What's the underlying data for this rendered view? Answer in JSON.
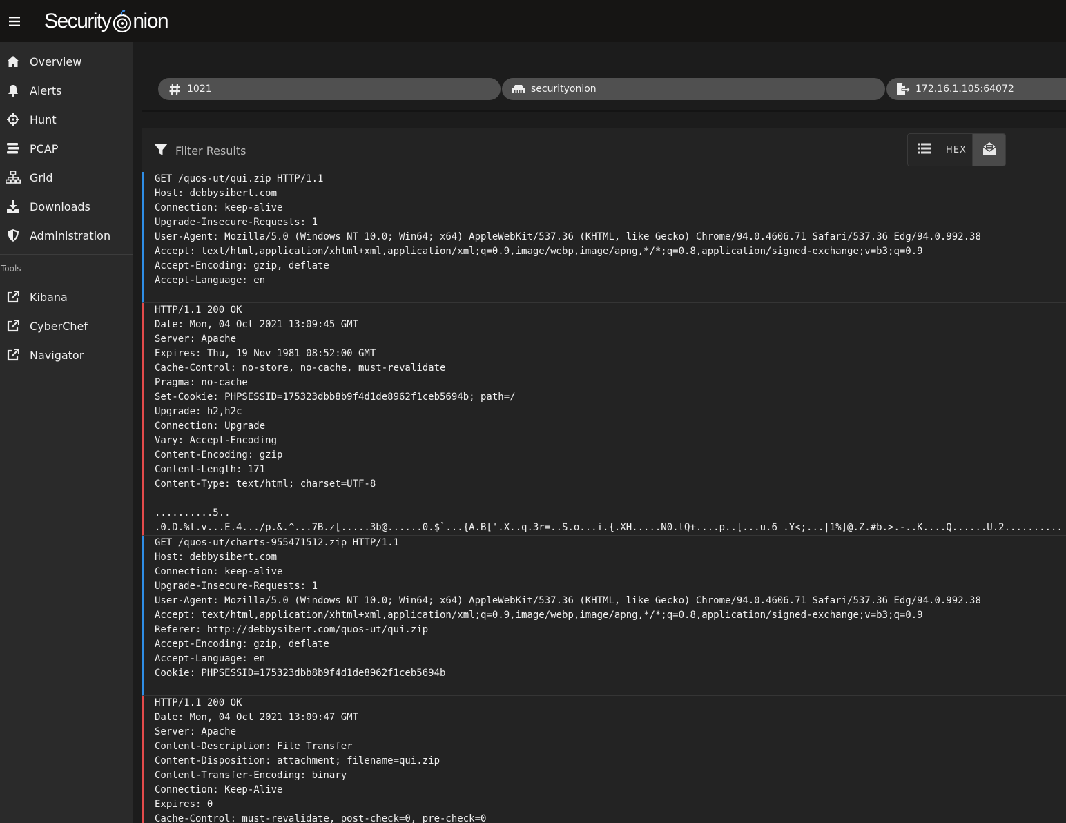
{
  "app": {
    "title": "Security Onion"
  },
  "sidebar": {
    "items": [
      {
        "label": "Overview",
        "icon": "home-icon"
      },
      {
        "label": "Alerts",
        "icon": "bell-icon"
      },
      {
        "label": "Hunt",
        "icon": "crosshairs-icon"
      },
      {
        "label": "PCAP",
        "icon": "stream-icon"
      },
      {
        "label": "Grid",
        "icon": "sitemap-icon"
      },
      {
        "label": "Downloads",
        "icon": "download-icon"
      },
      {
        "label": "Administration",
        "icon": "shield-icon"
      }
    ],
    "tools_heading": "Tools",
    "tools": [
      {
        "label": "Kibana",
        "icon": "external-link-icon"
      },
      {
        "label": "CyberChef",
        "icon": "external-link-icon"
      },
      {
        "label": "Navigator",
        "icon": "external-link-icon"
      }
    ]
  },
  "chips": [
    {
      "label": "1021",
      "icon": "hash-icon"
    },
    {
      "label": "securityonion",
      "icon": "sensor-icon"
    },
    {
      "label": "172.16.1.105:64072",
      "icon": "file-export-icon"
    }
  ],
  "filter": {
    "placeholder": "Filter Results"
  },
  "view_buttons": {
    "list": "list-icon",
    "hex": "HEX",
    "active": "envelope-open-icon"
  },
  "transcript": [
    {
      "direction": "request",
      "lines": [
        "GET /quos-ut/qui.zip HTTP/1.1",
        "Host: debbysibert.com",
        "Connection: keep-alive",
        "Upgrade-Insecure-Requests: 1",
        "User-Agent: Mozilla/5.0 (Windows NT 10.0; Win64; x64) AppleWebKit/537.36 (KHTML, like Gecko) Chrome/94.0.4606.71 Safari/537.36 Edg/94.0.992.38",
        "Accept: text/html,application/xhtml+xml,application/xml;q=0.9,image/webp,image/apng,*/*;q=0.8,application/signed-exchange;v=b3;q=0.9",
        "Accept-Encoding: gzip, deflate",
        "Accept-Language: en",
        ""
      ]
    },
    {
      "direction": "response",
      "lines": [
        "HTTP/1.1 200 OK",
        "Date: Mon, 04 Oct 2021 13:09:45 GMT",
        "Server: Apache",
        "Expires: Thu, 19 Nov 1981 08:52:00 GMT",
        "Cache-Control: no-store, no-cache, must-revalidate",
        "Pragma: no-cache",
        "Set-Cookie: PHPSESSID=175323dbb8b9f4d1de8962f1ceb5694b; path=/",
        "Upgrade: h2,h2c",
        "Connection: Upgrade",
        "Vary: Accept-Encoding",
        "Content-Encoding: gzip",
        "Content-Length: 171",
        "Content-Type: text/html; charset=UTF-8",
        "",
        "..........5..",
        ".0.D.%t.v...E.4.../p.&.^...7B.z[.....3b@......0.$`...{A.B['.X..q.3r=..S.o...i.{.XH.....N0.tQ+....p..[...u.6 .Y<;...|1%]@.Z.#b.>.-..K....Q......U.2.........."
      ]
    },
    {
      "direction": "request",
      "lines": [
        "GET /quos-ut/charts-955471512.zip HTTP/1.1",
        "Host: debbysibert.com",
        "Connection: keep-alive",
        "Upgrade-Insecure-Requests: 1",
        "User-Agent: Mozilla/5.0 (Windows NT 10.0; Win64; x64) AppleWebKit/537.36 (KHTML, like Gecko) Chrome/94.0.4606.71 Safari/537.36 Edg/94.0.992.38",
        "Accept: text/html,application/xhtml+xml,application/xml;q=0.9,image/webp,image/apng,*/*;q=0.8,application/signed-exchange;v=b3;q=0.9",
        "Referer: http://debbysibert.com/quos-ut/qui.zip",
        "Accept-Encoding: gzip, deflate",
        "Accept-Language: en",
        "Cookie: PHPSESSID=175323dbb8b9f4d1de8962f1ceb5694b",
        ""
      ]
    },
    {
      "direction": "response",
      "lines": [
        "HTTP/1.1 200 OK",
        "Date: Mon, 04 Oct 2021 13:09:47 GMT",
        "Server: Apache",
        "Content-Description: File Transfer",
        "Content-Disposition: attachment; filename=qui.zip",
        "Content-Transfer-Encoding: binary",
        "Connection: Keep-Alive",
        "Expires: 0",
        "Cache-Control: must-revalidate, post-check=0, pre-check=0"
      ]
    }
  ]
}
